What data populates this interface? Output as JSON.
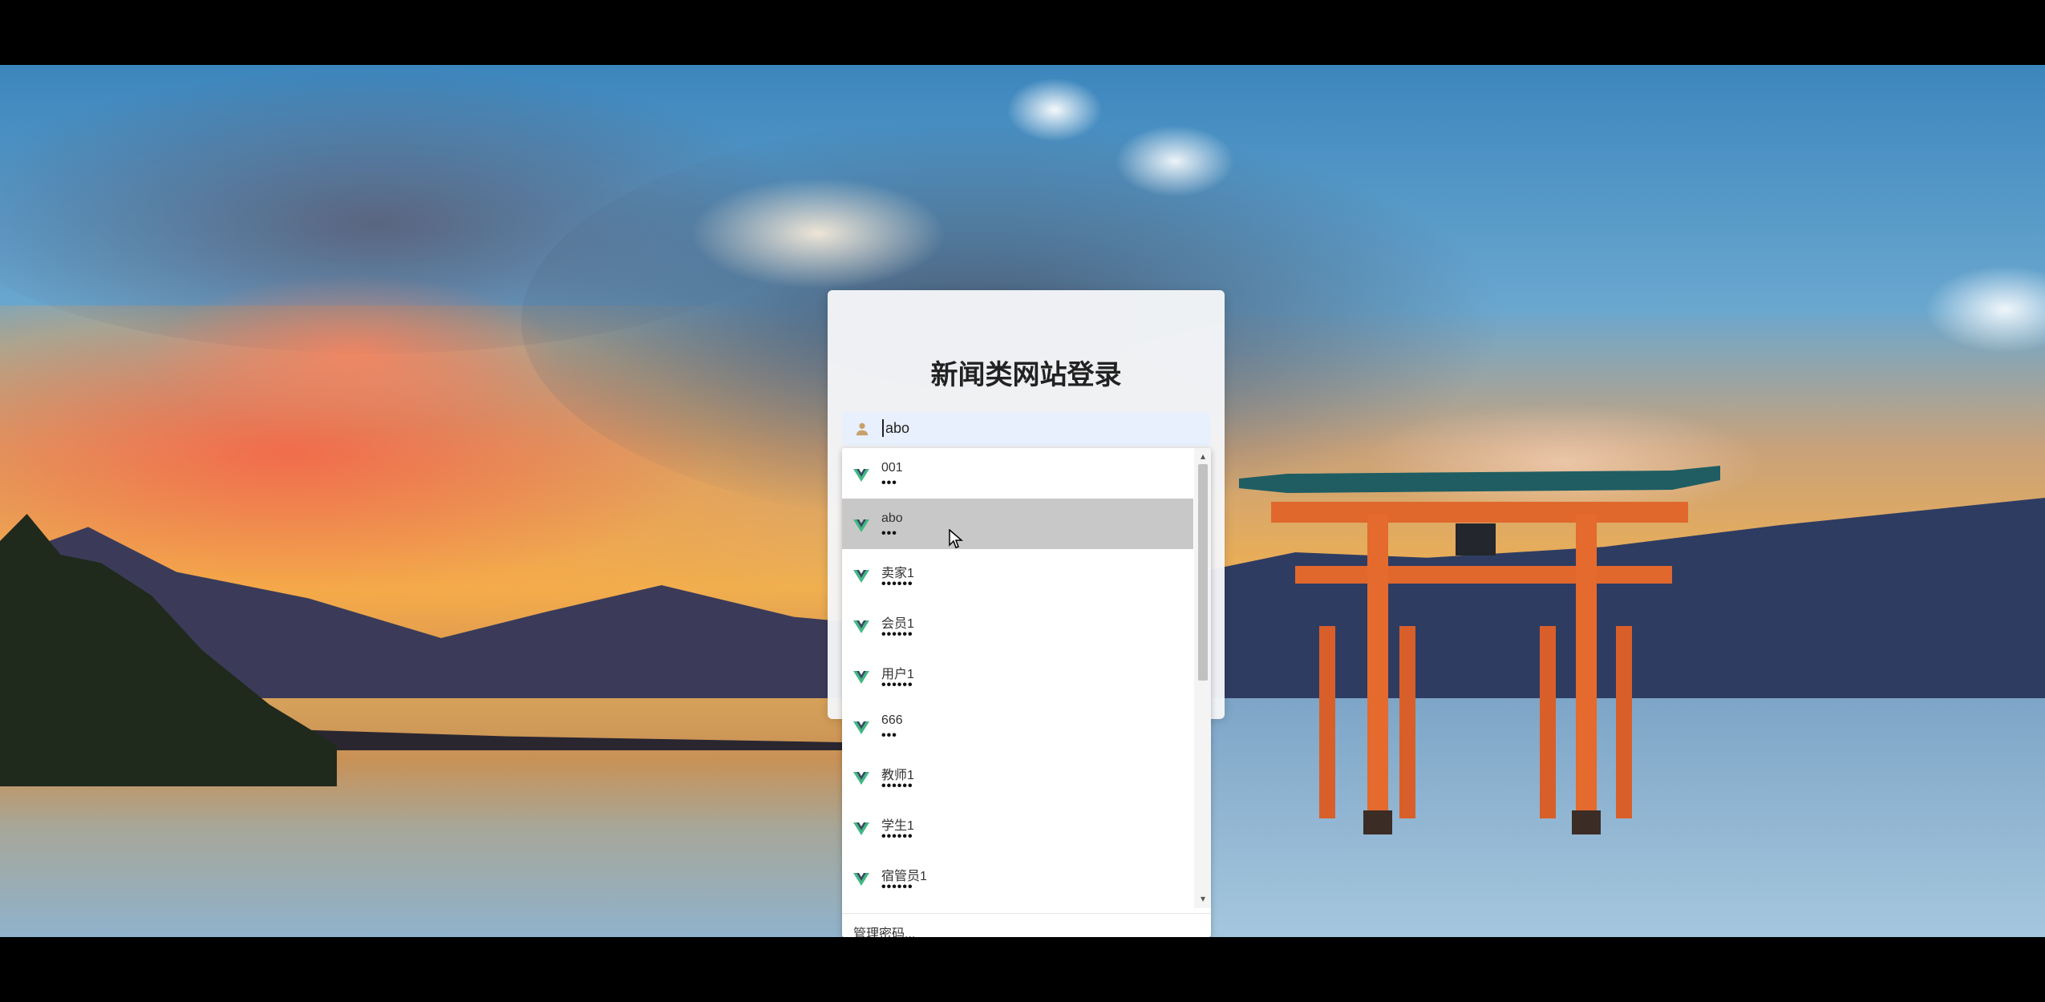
{
  "login": {
    "title": "新闻类网站登录",
    "username_value": "abo"
  },
  "autofill": {
    "items": [
      {
        "username": "001",
        "password_mask": "•••"
      },
      {
        "username": "abo",
        "password_mask": "•••"
      },
      {
        "username": "卖家1",
        "password_mask": "••••••"
      },
      {
        "username": "会员1",
        "password_mask": "••••••"
      },
      {
        "username": "用户1",
        "password_mask": "••••••"
      },
      {
        "username": "666",
        "password_mask": "•••"
      },
      {
        "username": "教师1",
        "password_mask": "••••••"
      },
      {
        "username": "学生1",
        "password_mask": "••••••"
      },
      {
        "username": "宿管员1",
        "password_mask": "••••••"
      }
    ],
    "active_index": 1,
    "manage_label": "管理密码..."
  },
  "colors": {
    "vue_green": "#41b883",
    "vue_dark": "#35495e",
    "card_bg": "#f5f6f8",
    "input_bg": "#e8f0fe"
  },
  "icons": {
    "user": "user-icon",
    "item_logo": "vue-logo-icon",
    "scroll_up": "chevron-up-icon",
    "scroll_down": "chevron-down-icon",
    "cursor": "mouse-cursor-icon"
  }
}
